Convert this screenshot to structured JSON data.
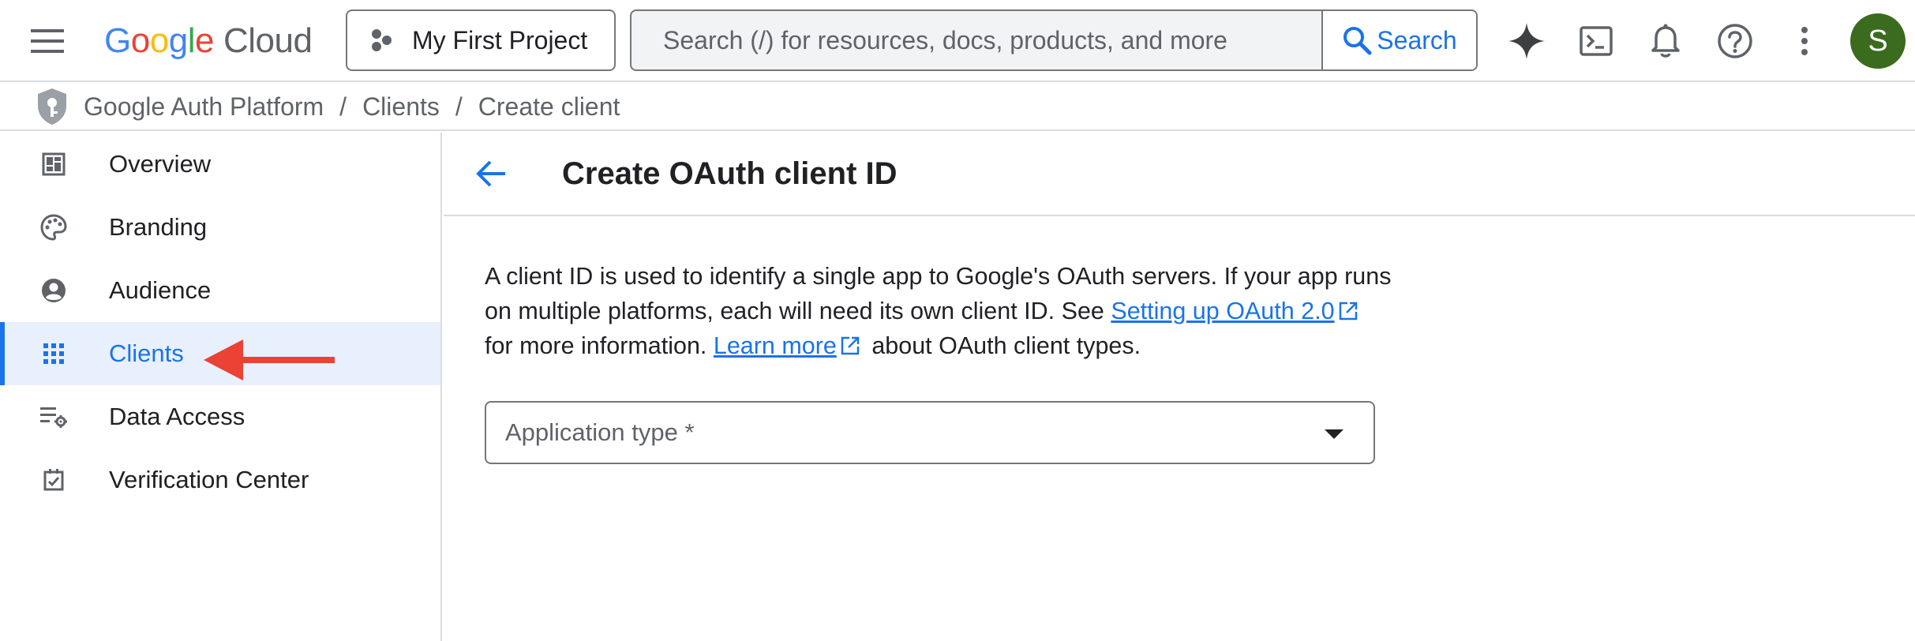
{
  "header": {
    "logo": {
      "letters": [
        "G",
        "o",
        "o",
        "g",
        "l",
        "e"
      ],
      "cloud": "Cloud"
    },
    "project_label": "My First Project",
    "search": {
      "placeholder": "Search (/) for resources, docs, products, and more",
      "button_label": "Search"
    },
    "icons": [
      "gemini-icon",
      "cloud-shell-icon",
      "notifications-icon",
      "help-icon",
      "more-vert-icon"
    ],
    "avatar_letter": "S",
    "avatar_color": "#3b6b1e"
  },
  "breadcrumb": {
    "items": [
      "Google Auth Platform",
      "Clients",
      "Create client"
    ],
    "separator": "/"
  },
  "sidebar": {
    "items": [
      {
        "label": "Overview",
        "icon": "dashboard-icon"
      },
      {
        "label": "Branding",
        "icon": "palette-icon"
      },
      {
        "label": "Audience",
        "icon": "account-circle-icon"
      },
      {
        "label": "Clients",
        "icon": "apps-grid-icon",
        "active": true
      },
      {
        "label": "Data Access",
        "icon": "data-access-icon"
      },
      {
        "label": "Verification Center",
        "icon": "verification-icon"
      }
    ],
    "annotation_color": "#ea4335"
  },
  "main": {
    "title": "Create OAuth client ID",
    "description": {
      "part1": "A client ID is used to identify a single app to Google's OAuth servers. If your app runs on multiple platforms, each will need its own client ID. See ",
      "link1": "Setting up OAuth 2.0",
      "part2": " for more information. ",
      "link2": "Learn more",
      "part3": " about OAuth client types."
    },
    "application_type": {
      "placeholder": "Application type *",
      "value": ""
    }
  },
  "colors": {
    "accent": "#1a73e8",
    "active_bg": "#e8f0fe",
    "border": "#dadce0",
    "text": "#202124",
    "muted": "#5f6368"
  }
}
